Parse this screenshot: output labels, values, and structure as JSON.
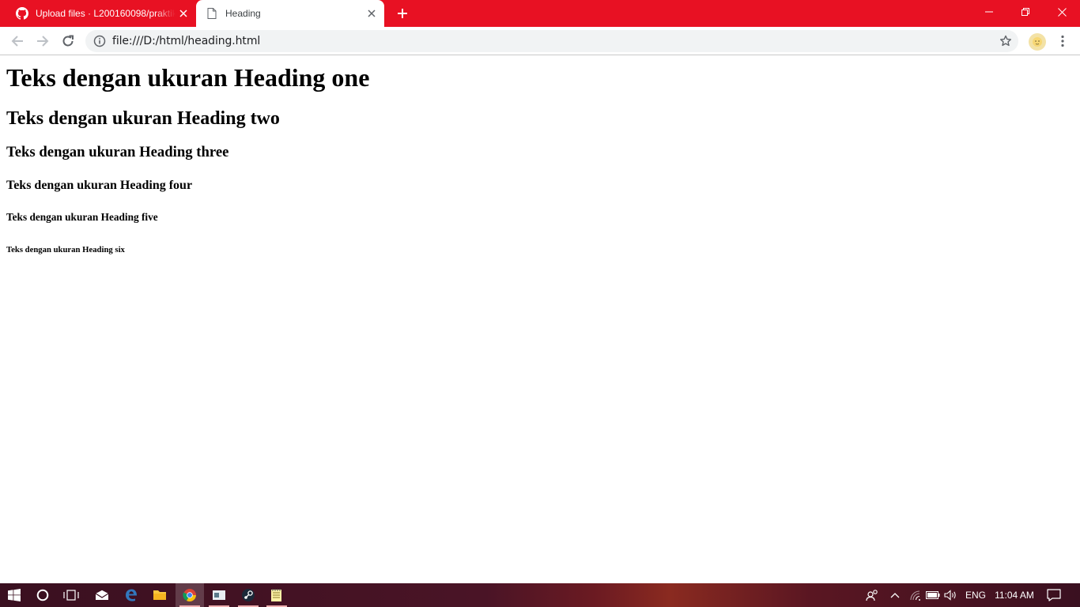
{
  "browser": {
    "tabs": [
      {
        "title": "Upload files · L200160098/praktikum",
        "icon": "github-icon",
        "active": false
      },
      {
        "title": "Heading",
        "icon": "page-icon",
        "active": true
      }
    ],
    "address": {
      "url": "file:///D:/html/heading.html"
    },
    "accent_color": "#e81123"
  },
  "page": {
    "h1": "Teks dengan ukuran Heading one",
    "h2": "Teks dengan ukuran Heading two",
    "h3": "Teks dengan ukuran Heading three",
    "h4": "Teks dengan ukuran Heading four",
    "h5": "Teks dengan ukuran Heading five",
    "h6": "Teks dengan ukuran Heading six"
  },
  "taskbar": {
    "apps": [
      "start-icon",
      "cortana-icon",
      "task-view-icon",
      "mail-icon",
      "edge-icon",
      "file-explorer-icon",
      "chrome-icon",
      "app-icon",
      "steam-icon",
      "notepad-icon"
    ],
    "language": "ENG",
    "time": "11:04 AM"
  }
}
